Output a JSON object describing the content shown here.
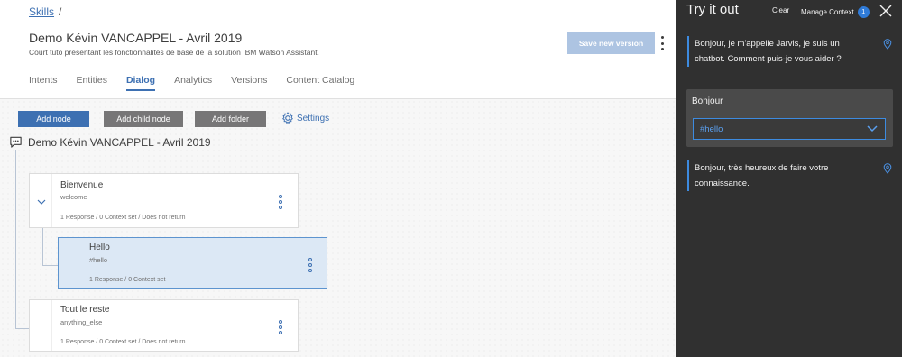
{
  "breadcrumb": {
    "link": "Skills",
    "sep": "/"
  },
  "skill": {
    "title": "Demo Kévin VANCAPPEL - Avril 2019",
    "subtitle": "Court tuto présentant les fonctionnalités de base de la solution IBM Watson Assistant."
  },
  "header": {
    "save_label": "Save new version"
  },
  "tabs": [
    {
      "label": "Intents",
      "active": false
    },
    {
      "label": "Entities",
      "active": false
    },
    {
      "label": "Dialog",
      "active": true
    },
    {
      "label": "Analytics",
      "active": false
    },
    {
      "label": "Versions",
      "active": false
    },
    {
      "label": "Content Catalog",
      "active": false
    }
  ],
  "toolbar": {
    "add_node": "Add node",
    "add_child_node": "Add child node",
    "add_folder": "Add folder",
    "settings": "Settings"
  },
  "dialog": {
    "root_title": "Demo Kévin VANCAPPEL - Avril 2019",
    "nodes": [
      {
        "name": "Bienvenue",
        "condition": "welcome",
        "meta": "1 Response / 0 Context set / Does not return"
      },
      {
        "name": "Hello",
        "condition": "#hello",
        "meta": "1 Response / 0 Context set"
      },
      {
        "name": "Tout le reste",
        "condition": "anything_else",
        "meta": "1 Response / 0 Context set / Does not return"
      }
    ]
  },
  "try_panel": {
    "title": "Try it out",
    "clear": "Clear",
    "manage_context": "Manage Context",
    "context_count": "1",
    "messages": [
      {
        "from": "bot",
        "text": "Bonjour, je m'appelle Jarvis, je suis un chatbot. Comment puis-je vous aider ?"
      },
      {
        "from": "user",
        "text": "Bonjour",
        "intent": "#hello"
      },
      {
        "from": "bot",
        "text": "Bonjour, très heureux de faire votre connaissance."
      }
    ]
  },
  "colors": {
    "accent": "#3d70b2",
    "panel_bg": "#303030",
    "selected_bg": "#dce8f5"
  }
}
